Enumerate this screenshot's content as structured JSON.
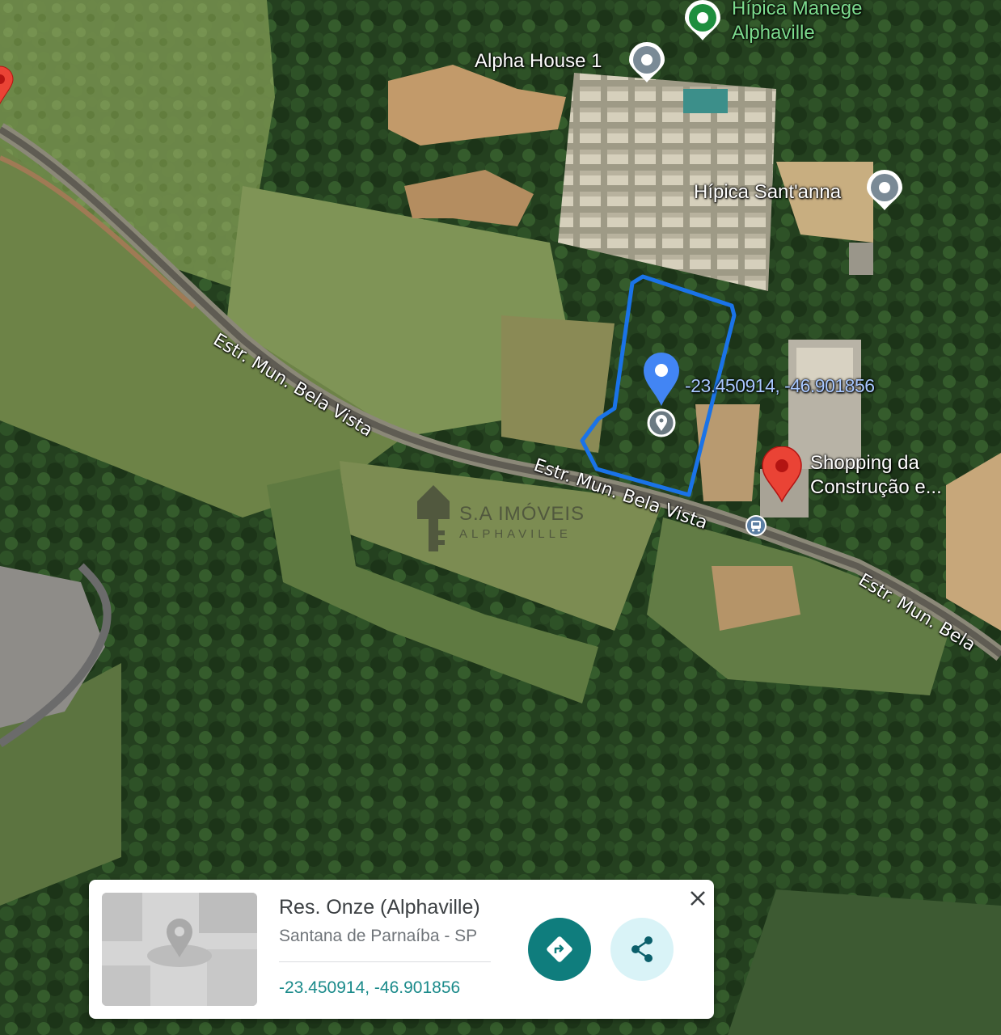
{
  "map": {
    "type": "satellite",
    "colors": {
      "boundary": "#1a73e8",
      "user_pin": "#4285f4",
      "place_pin": "#ea4335",
      "green_pin": "#1e8e3e"
    }
  },
  "places": [
    {
      "name": "Hípica Manege",
      "name2": "Alphaville",
      "icon": "green-place-pin-icon"
    },
    {
      "name": "Alpha House 1",
      "icon": "gray-place-pin-icon"
    },
    {
      "name": "Hípica Sant'anna",
      "icon": "gray-place-pin-icon"
    },
    {
      "name": "Shopping da",
      "name2": "Construção e...",
      "icon": "red-place-pin-icon"
    }
  ],
  "roads": [
    {
      "name": "Estr. Mun. Bela Vista"
    },
    {
      "name": "Estr. Mun. Bela Vista"
    },
    {
      "name": "Estr. Mun. Bela"
    }
  ],
  "dropped_pin": {
    "coords_label": "-23.450914, -46.901856"
  },
  "watermark": {
    "title": "S.A IMÓVEIS",
    "subtitle": "ALPHAVILLE"
  },
  "info_card": {
    "title": "Res. Onze (Alphaville)",
    "subtitle": "Santana de Parnaíba - SP",
    "coords": "-23.450914, -46.901856",
    "close_icon": "close-icon",
    "directions_icon": "directions-icon",
    "share_icon": "share-icon"
  }
}
